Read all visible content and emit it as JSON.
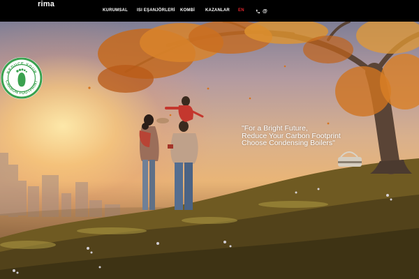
{
  "brand": {
    "logo_text": "rima"
  },
  "nav": {
    "items": [
      {
        "label": "KURUMSAL"
      },
      {
        "label": "ISI EŞANJÖRLERİ"
      },
      {
        "label": "KOMBİ"
      },
      {
        "label": "KAZANLAR"
      },
      {
        "label": "EN"
      }
    ],
    "contact": {
      "phone_icon": "phone-icon",
      "email_icon": "at-icon",
      "email_glyph": "@"
    }
  },
  "badge": {
    "text_top": "REDUCE YOUR",
    "text_bottom": "CARBON FOOTPRINT",
    "icon": "footprint-icon"
  },
  "hero": {
    "quote_lines": [
      "\"For a Bright Future,",
      " Reduce Your Carbon Footprint",
      " Choose Condensing Boilers\""
    ]
  },
  "colors": {
    "nav_background": "#000000",
    "nav_text": "#ffffff",
    "nav_active": "#e3252d",
    "badge_green": "#3aa14f"
  }
}
